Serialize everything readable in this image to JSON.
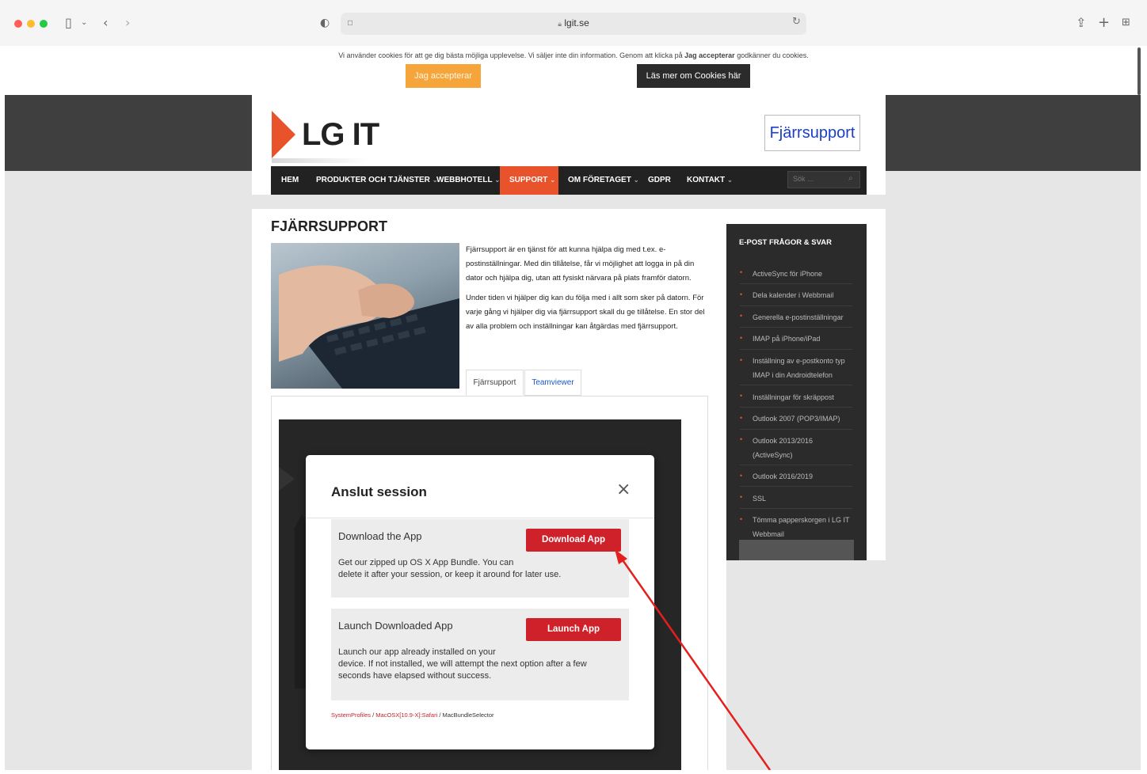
{
  "browser": {
    "url": "lgit.se"
  },
  "cookie": {
    "text_prefix": "Vi använder cookies för att ge dig bästa möjliga upplevelse. Vi säljer inte din information. Genom att klicka på ",
    "text_bold": "Jag accepterar",
    "text_suffix": " godkänner du cookies.",
    "accept_label": "Jag accepterar",
    "more_label": "Läs mer om Cookies här"
  },
  "site": {
    "logo": "LG IT",
    "remote_support_button": "Fjärrsupport",
    "nav": [
      {
        "label": "HEM",
        "chevron": false
      },
      {
        "label": "PRODUKTER OCH TJÄNSTER",
        "chevron": true
      },
      {
        "label": "WEBBHOTELL",
        "chevron": true
      },
      {
        "label": "SUPPORT",
        "chevron": true,
        "active": true
      },
      {
        "label": "OM FÖRETAGET",
        "chevron": true
      },
      {
        "label": "GDPR",
        "chevron": false
      },
      {
        "label": "KONTAKT",
        "chevron": true
      }
    ],
    "search_placeholder": "Sök ...",
    "page_title": "FJÄRRSUPPORT",
    "paragraph1": "Fjärrsupport är en tjänst för att kunna hjälpa dig med t.ex. e-postinställningar. Med din tillåtelse, får vi möjlighet att logga in på din dator och hjälpa dig, utan att fysiskt närvara på plats framför datorn.",
    "paragraph2": "Under tiden vi hjälper dig kan du följa med i allt som sker på datorn. För varje gång vi hjälper dig via fjärrsupport skall du ge tillåtelse. En stor del av alla problem och inställningar kan åtgärdas med fjärrsupport.",
    "tabs": [
      "Fjärrsupport",
      "Teamviewer"
    ]
  },
  "sidebar": {
    "title": "E-POST FRÅGOR & SVAR",
    "items": [
      "ActiveSync för iPhone",
      "Dela kalender i Webbmail",
      "Generella e-postinställningar",
      "IMAP på iPhone/iPad",
      "Inställning av e-postkonto typ IMAP i din Androidtelefon",
      "Inställningar för skräppost",
      "Outlook 2007 (POP3/IMAP)",
      "Outlook 2013/2016 (ActiveSync)",
      "Outlook 2016/2019",
      "SSL",
      "Tömma papperskorgen i LG IT Webbmail"
    ],
    "bullet_color": "#e8532b"
  },
  "modal": {
    "title": "Anslut session",
    "download_title": "Download the App",
    "download_button": "Download App",
    "download_desc1": "Get our zipped up OS X App Bundle. You can",
    "download_desc2": "delete it after your session, or keep it around for later use.",
    "launch_title": "Launch Downloaded App",
    "launch_button": "Launch App",
    "launch_desc1": "Launch our app already installed on your",
    "launch_desc2": "device. If not installed, we will attempt the next option after a few",
    "launch_desc3": "seconds have elapsed without success.",
    "footer_link1": "SystemProfiles",
    "footer_sep1": " / ",
    "footer_link2": "MacOSX[10.9-X]:Safari",
    "footer_sep2": " / ",
    "footer_plain": "MacBundleSelector"
  },
  "colors": {
    "accent_orange": "#e8532b",
    "accept_button": "#f5a53a",
    "primary_red": "#cf2129",
    "annotation_arrow": "#e3201e"
  }
}
